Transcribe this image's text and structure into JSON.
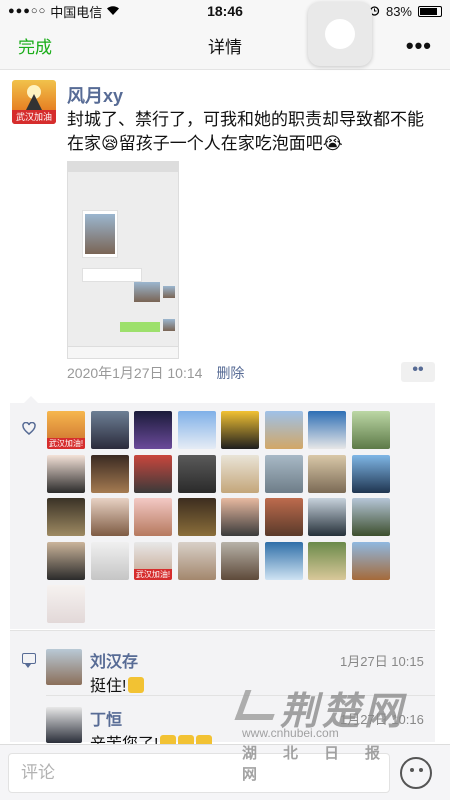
{
  "status_bar": {
    "signal": "●●●○○",
    "carrier": "中国电信",
    "time": "18:46",
    "battery": "83%",
    "battery_level": 0.83
  },
  "nav": {
    "done_label": "完成",
    "title": "详情",
    "more_label": "•••"
  },
  "post": {
    "author": "风月xy",
    "avatar_badge": "武汉加油",
    "text": "封城了、禁行了，可我和她的职责却导致都不能在家😪留孩子一个人在家吃泡面吧😭",
    "date": "2020年1月27日 10:14",
    "delete_label": "删除",
    "more_button": "••"
  },
  "likes": {
    "badge_text": "武汉加油!",
    "badge_text_2": "武汉加油!",
    "avatar_count": 33
  },
  "comments": [
    {
      "author": "刘汉存",
      "time": "1月27日 10:15",
      "text": "挺住!"
    },
    {
      "author": "丁恒",
      "time": "1月27日 10:16",
      "text": "辛苦您了!"
    }
  ],
  "input": {
    "placeholder": "评论"
  },
  "watermark": {
    "title": "荆楚网",
    "url": "www.cnhubei.com",
    "subtitle": "湖北日报网"
  },
  "colors": {
    "link": "#576b95",
    "accent": "#1aad19",
    "like_panel": "#f3f3f5"
  }
}
